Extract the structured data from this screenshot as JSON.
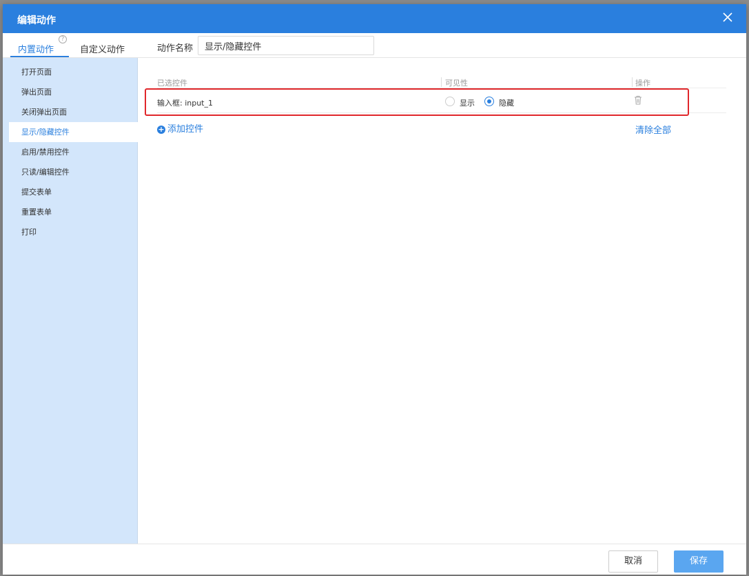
{
  "dialog": {
    "title": "编辑动作"
  },
  "tabs": {
    "builtin": "内置动作",
    "custom": "自定义动作",
    "help": "?"
  },
  "menu": {
    "items": [
      {
        "label": "打开页面"
      },
      {
        "label": "弹出页面"
      },
      {
        "label": "关闭弹出页面"
      },
      {
        "label": "显示/隐藏控件"
      },
      {
        "label": "启用/禁用控件"
      },
      {
        "label": "只读/编辑控件"
      },
      {
        "label": "提交表单"
      },
      {
        "label": "重置表单"
      },
      {
        "label": "打印"
      }
    ],
    "active_index": 3
  },
  "action_name": {
    "label": "动作名称",
    "value": "显示/隐藏控件"
  },
  "table": {
    "headers": {
      "selected": "已选控件",
      "visibility": "可见性",
      "operation": "操作"
    },
    "rows": [
      {
        "control": "输入框: input_1",
        "show_label": "显示",
        "hide_label": "隐藏",
        "selected": "隐藏"
      }
    ]
  },
  "links": {
    "add_control": "添加控件",
    "add_icon": "+",
    "clear_all": "清除全部"
  },
  "footer": {
    "cancel": "取消",
    "save": "保存"
  },
  "colors": {
    "accent": "#2a7fde",
    "highlight_border": "#e0262a",
    "sidebar_bg": "#d3e6fb"
  }
}
